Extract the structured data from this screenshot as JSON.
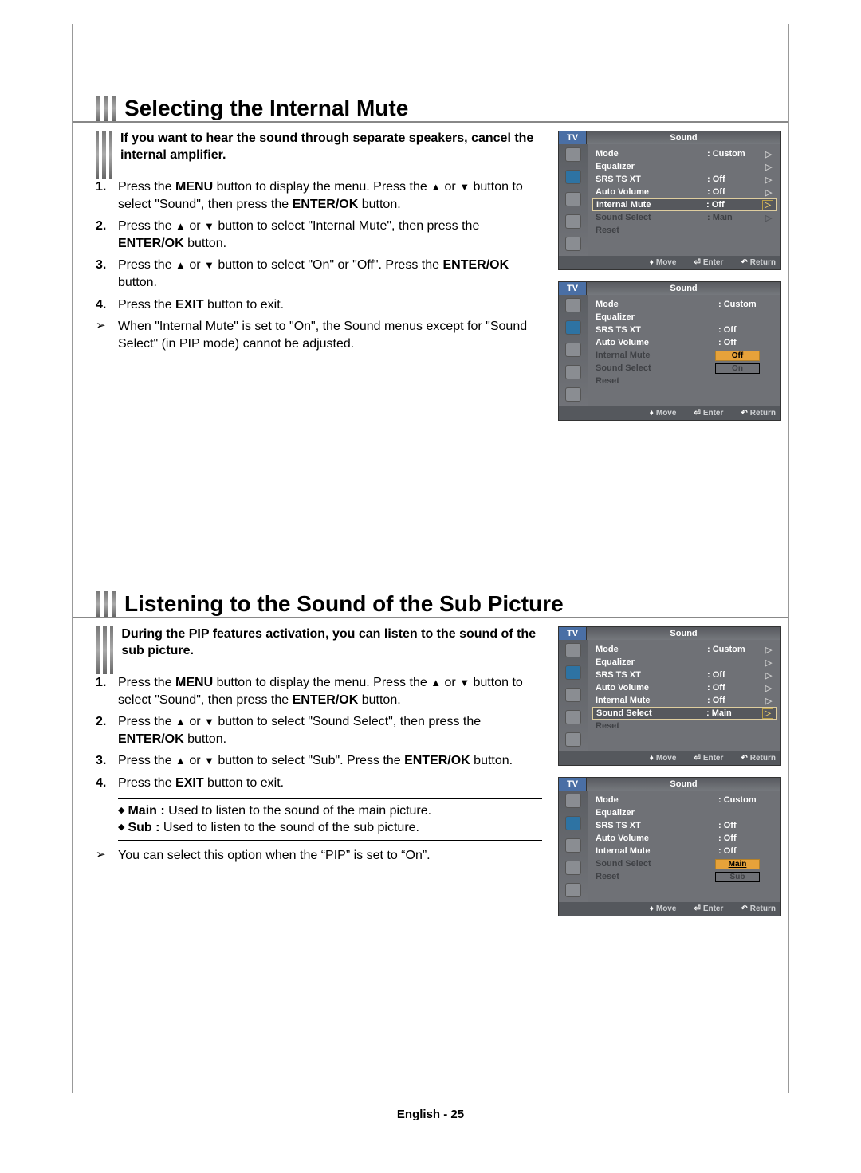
{
  "footer": "English - 25",
  "section1": {
    "title": "Selecting the Internal Mute",
    "intro": "If you want to hear the sound through separate speakers, cancel the internal amplifier.",
    "steps": [
      "Press the <b>MENU</b> button to display the menu. Press the <span class='arrow'>▲</span> or <span class='arrow'>▼</span> button to select \"Sound\", then press the <b>ENTER/OK</b> button.",
      "Press the <span class='arrow'>▲</span> or <span class='arrow'>▼</span> button to select \"Internal Mute\", then press the <b>ENTER/OK</b> button.",
      "Press the <span class='arrow'>▲</span> or <span class='arrow'>▼</span> button to select \"On\" or \"Off\". Press the <b>ENTER/OK</b> button.",
      "Press the <b>EXIT</b> button to exit."
    ],
    "note": "When \"Internal Mute\" is set to \"On\", the Sound menus except for \"Sound Select\" (in PIP mode) cannot be adjusted."
  },
  "section2": {
    "title": "Listening to the Sound of the Sub Picture",
    "intro": "During the PIP features activation, you can listen to the sound of the sub picture.",
    "steps": [
      "Press the <b>MENU</b> button to display the menu. Press the <span class='arrow'>▲</span> or <span class='arrow'>▼</span> button to select \"Sound\", then press the <b>ENTER/OK</b> button.",
      "Press the <span class='arrow'>▲</span> or <span class='arrow'>▼</span> button to select \"Sound Select\", then press the <b>ENTER/OK</b> button.",
      "Press the <span class='arrow'>▲</span> or <span class='arrow'>▼</span> button to select \"Sub\". Press the <b>ENTER/OK</b> button.",
      "Press the <b>EXIT</b> button to exit."
    ],
    "defs": [
      "<b>Main :</b> Used to listen to the sound of the main picture.",
      "<b>Sub  :</b>  Used to listen to the sound of the sub picture."
    ],
    "note": "You can select this option when the “PIP” is set to “On”."
  },
  "osd": {
    "tv": "TV",
    "title": "Sound",
    "bottom": {
      "move": "Move",
      "enter": "Enter",
      "return": "Return"
    },
    "rows_labels": {
      "mode": "Mode",
      "equalizer": "Equalizer",
      "srs": "SRS TS XT",
      "auto_volume": "Auto Volume",
      "internal_mute": "Internal Mute",
      "sound_select": "Sound Select",
      "reset": "Reset"
    },
    "vals": {
      "custom": ": Custom",
      "off": ": Off",
      "main": ": Main",
      "colon": ":"
    },
    "opts": {
      "off": "Off",
      "on": "On",
      "main": "Main",
      "sub": "Sub"
    }
  }
}
